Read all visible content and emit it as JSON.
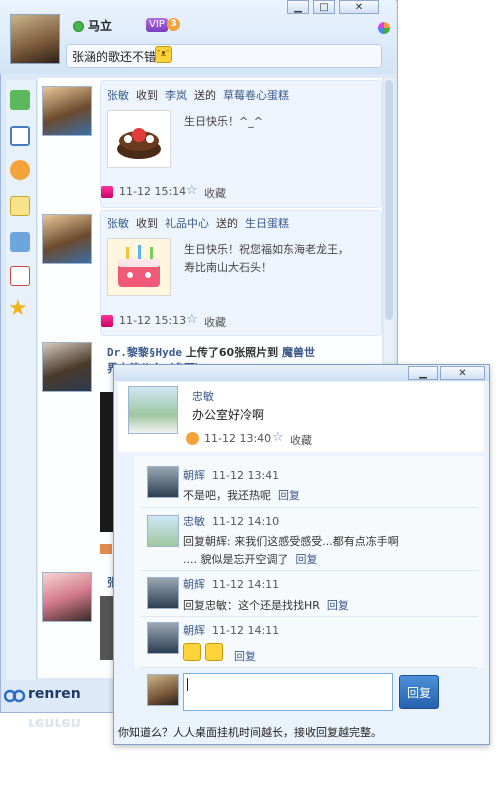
{
  "main": {
    "username": "马立",
    "vip_label": "VIP",
    "vip_level": "3",
    "status": "张涵的歌还不错",
    "window_buttons": [
      "▁",
      "□",
      "✕"
    ]
  },
  "feed": [
    {
      "name": "张敏",
      "verb": "收到",
      "from": "李岚",
      "mid": "送的",
      "gift": "草莓卷心蛋糕",
      "message": "生日快乐！^_^",
      "time": "11-12 15:14",
      "collect": "收藏"
    },
    {
      "name": "张敏",
      "verb": "收到",
      "from": "礼品中心",
      "mid": "送的",
      "gift": "生日蛋糕",
      "message_l1": "生日快乐！祝您福如东海老龙王，",
      "message_l2": "寿比南山大石头！",
      "time": "11-12 15:13",
      "collect": "收藏"
    },
    {
      "name": "Dr.黎黎§Hyde",
      "action": "上传了60张照片到",
      "album": "魔兽世",
      "album_l2": "界卡德公会（多图）"
    },
    {
      "name": "张"
    }
  ],
  "logo": "renren",
  "popup": {
    "window_buttons": [
      "▁",
      "✕"
    ],
    "post": {
      "name": "忠敏",
      "text": "办公室好冷啊",
      "time": "11-12 13:40",
      "collect": "收藏"
    },
    "comments": [
      {
        "name": "朝辉",
        "time": "11-12 13:41",
        "text": "不是吧，我还热呢",
        "reply": "回复"
      },
      {
        "name": "忠敏",
        "time": "11-12 14:10",
        "text_l1": "回复朝辉:  来我们这感受感受...都有点冻手啊",
        "text_l2": "....  貌似是忘开空调了",
        "reply": "回复"
      },
      {
        "name": "朝辉",
        "time": "11-12 14:11",
        "text": "回复忠敏：这个还是找找HR",
        "reply": "回复"
      },
      {
        "name": "朝辉",
        "time": "11-12 14:11",
        "reply": "回复"
      }
    ],
    "reply_button": "回复",
    "tip": "你知道么？人人桌面挂机时间越长，接收回复越完整。"
  }
}
